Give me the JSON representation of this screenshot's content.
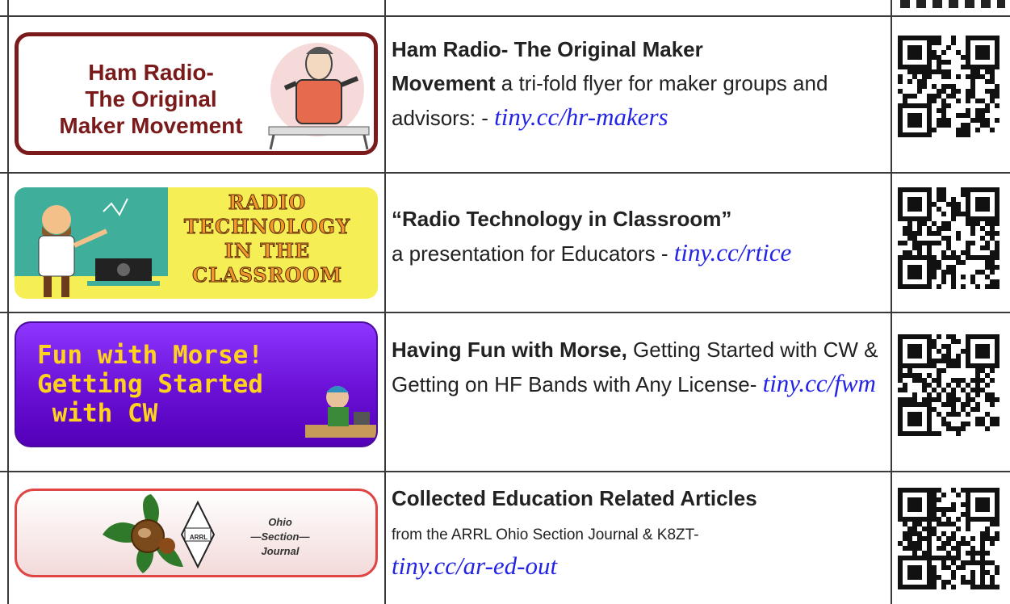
{
  "rows": [
    {
      "banner_lines": [
        "Ham Radio-",
        "The Original",
        "Maker Movement"
      ],
      "title": "Ham Radio- The Original Maker",
      "title2": "Movement",
      "text": " a tri-fold flyer for maker groups and advisors: - ",
      "link": "tiny.cc/hr-makers"
    },
    {
      "banner_lines": [
        "RADIO",
        "TECHNOLOGY",
        "IN THE",
        "CLASSROOM"
      ],
      "title": "“Radio Technology in Classroom”",
      "text": "a presentation for Educators - ",
      "link": "tiny.cc/rtice"
    },
    {
      "banner_lines": [
        "Fun with Morse!",
        "Getting Started",
        " with CW"
      ],
      "title": "Having Fun with Morse,",
      "text": " Getting Started with CW & Getting on HF Bands with Any License-   ",
      "link": "tiny.cc/fwm"
    },
    {
      "banner_lines": [
        "Ohio",
        "—Section—",
        "Journal"
      ],
      "banner_logo_text": "ARRL",
      "title": "Collected Education Related Articles",
      "text": "from the ARRL Ohio Section Journal & K8ZT-",
      "link": "tiny.cc/ar-ed-out"
    }
  ]
}
